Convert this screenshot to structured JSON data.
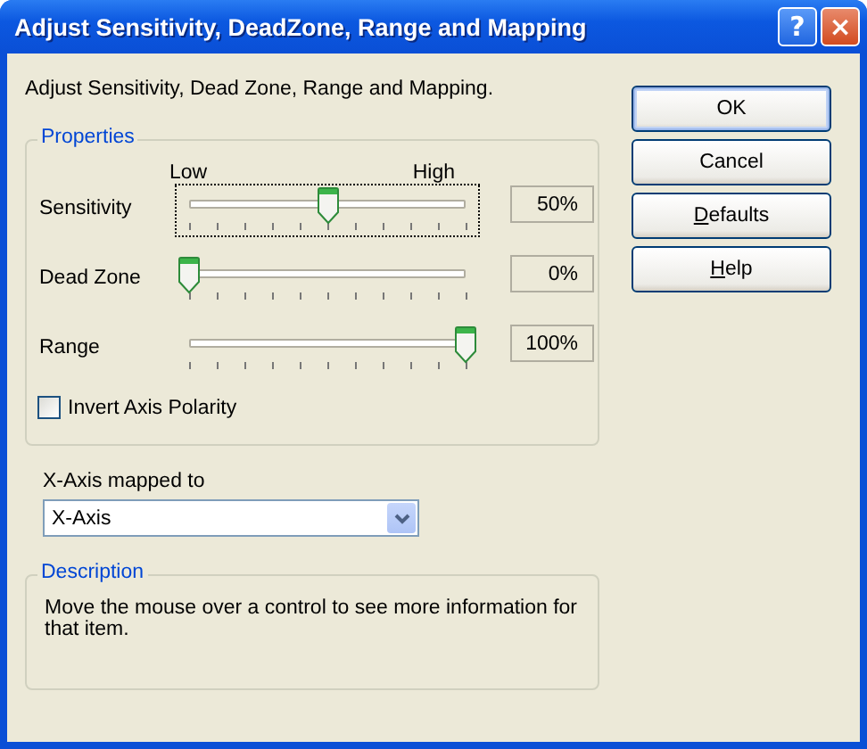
{
  "window": {
    "title": "Adjust Sensitivity, DeadZone, Range and Mapping",
    "help_button": "?",
    "close_button": "×"
  },
  "intro": "Adjust Sensitivity, Dead Zone, Range and Mapping.",
  "properties": {
    "title": "Properties",
    "low_label": "Low",
    "high_label": "High",
    "sliders": [
      {
        "label": "Sensitivity",
        "level": 0.5,
        "reading": "50%",
        "focused": true
      },
      {
        "label": "Dead Zone",
        "level": 0,
        "reading": "0%",
        "focused": false
      },
      {
        "label": "Range",
        "level": 1,
        "reading": "100%",
        "focused": false
      }
    ],
    "invert": {
      "label": "Invert Axis Polarity",
      "checked": false
    }
  },
  "mapping": {
    "label": "X-Axis mapped to",
    "value": "X-Axis"
  },
  "description": {
    "title": "Description",
    "text": "Move the mouse over a control to see more information for that item."
  },
  "buttons": [
    {
      "label": "OK",
      "default": true,
      "underline_first": false
    },
    {
      "label": "Cancel",
      "default": false,
      "underline_first": false
    },
    {
      "label": "Defaults",
      "default": false,
      "underline_first": true
    },
    {
      "label": "Help",
      "default": false,
      "underline_first": true
    }
  ]
}
